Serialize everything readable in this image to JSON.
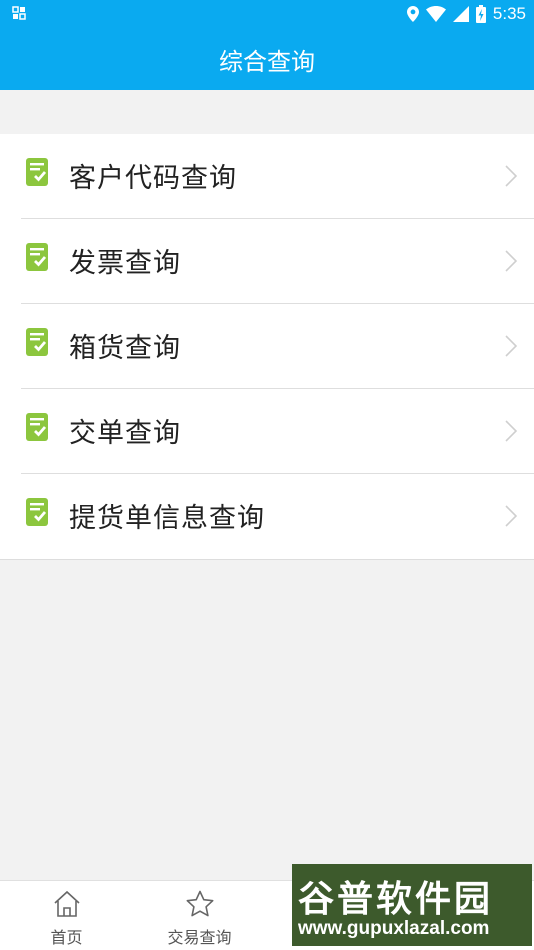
{
  "status_bar": {
    "time": "5:35"
  },
  "app_bar": {
    "title": "综合查询"
  },
  "list": {
    "items": [
      {
        "label": "客户代码查询"
      },
      {
        "label": "发票查询"
      },
      {
        "label": "箱货查询"
      },
      {
        "label": "交单查询"
      },
      {
        "label": "提货单信息查询"
      }
    ]
  },
  "bottom_nav": {
    "tabs": [
      {
        "label": "首页",
        "icon": "home-icon"
      },
      {
        "label": "交易查询",
        "icon": "star-icon"
      }
    ]
  },
  "watermark": {
    "name": "谷普软件园",
    "url": "www.gupuxlazal.com"
  },
  "colors": {
    "primary": "#0aaaf0",
    "icon_green": "#8cc63e",
    "background": "#f2f2f2"
  }
}
